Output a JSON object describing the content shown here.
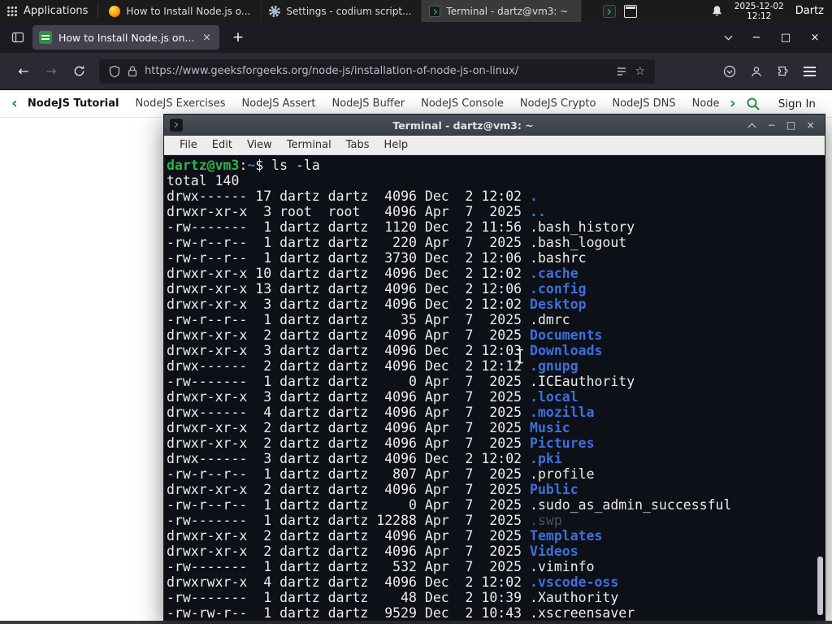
{
  "icons": {
    "back": "←",
    "forward": "→",
    "new_tab": "+",
    "close": "×",
    "minimize": "−",
    "maximize": "□",
    "star": "☆",
    "chev_left": "‹",
    "chev_right": "›"
  },
  "colors": {
    "gfg_green": "#2f8d46",
    "dir_blue": "#3d6fe0",
    "prompt_green": "#2fb34a"
  },
  "panel": {
    "applications": "Applications",
    "tasks": [
      {
        "title": "How to Install Node.js o...",
        "icon": "firefox-icon",
        "state": "normal"
      },
      {
        "title": "Settings - codium script...",
        "icon": "settings-icon",
        "state": "normal"
      },
      {
        "title": "Terminal - dartz@vm3: ~",
        "icon": "terminal-icon",
        "state": "active"
      }
    ],
    "clock": {
      "date": "2025-12-02",
      "time": "12:12"
    },
    "user": "Dartz"
  },
  "browser": {
    "tab_title": "How to Install Node.js on...",
    "url": "https://www.geeksforgeeks.org/node-js/installation-of-node-js-on-linux/",
    "gfg_nav": {
      "items": [
        {
          "label": "NodeJS Tutorial",
          "style": "current"
        },
        {
          "label": "NodeJS Exercises",
          "style": "normal"
        },
        {
          "label": "NodeJS Assert",
          "style": "normal"
        },
        {
          "label": "NodeJS Buffer",
          "style": "normal"
        },
        {
          "label": "NodeJS Console",
          "style": "normal"
        },
        {
          "label": "NodeJS Crypto",
          "style": "normal"
        },
        {
          "label": "NodeJS DNS",
          "style": "normal"
        },
        {
          "label": "Node",
          "style": "normal"
        }
      ],
      "sign_in": "Sign In"
    }
  },
  "terminal": {
    "title": "Terminal - dartz@vm3: ~",
    "menu": [
      "File",
      "Edit",
      "View",
      "Terminal",
      "Tabs",
      "Help"
    ],
    "prompt": {
      "user_host": "dartz@vm3",
      "colon": ":",
      "path": "~",
      "dollar": "$ ",
      "command": "ls -la"
    },
    "total_line": "total 140",
    "listing": [
      {
        "pre": "drwx------ 17 dartz dartz  4096 Dec  2 12:02 ",
        "name": ".",
        "type": "dir"
      },
      {
        "pre": "drwxr-xr-x  3 root  root   4096 Apr  7  2025 ",
        "name": "..",
        "type": "dir"
      },
      {
        "pre": "-rw-------  1 dartz dartz  1120 Dec  2 11:56 ",
        "name": ".bash_history",
        "type": "file"
      },
      {
        "pre": "-rw-r--r--  1 dartz dartz   220 Apr  7  2025 ",
        "name": ".bash_logout",
        "type": "file"
      },
      {
        "pre": "-rw-r--r--  1 dartz dartz  3730 Dec  2 12:06 ",
        "name": ".bashrc",
        "type": "file"
      },
      {
        "pre": "drwxr-xr-x 10 dartz dartz  4096 Dec  2 12:02 ",
        "name": ".cache",
        "type": "dir"
      },
      {
        "pre": "drwxr-xr-x 13 dartz dartz  4096 Dec  2 12:06 ",
        "name": ".config",
        "type": "dir"
      },
      {
        "pre": "drwxr-xr-x  3 dartz dartz  4096 Dec  2 12:02 ",
        "name": "Desktop",
        "type": "dir"
      },
      {
        "pre": "-rw-r--r--  1 dartz dartz    35 Apr  7  2025 ",
        "name": ".dmrc",
        "type": "file"
      },
      {
        "pre": "drwxr-xr-x  2 dartz dartz  4096 Apr  7  2025 ",
        "name": "Documents",
        "type": "dir"
      },
      {
        "pre": "drwxr-xr-x  3 dartz dartz  4096 Dec  2 12:03 ",
        "name": "Downloads",
        "type": "dir"
      },
      {
        "pre": "drwx------  2 dartz dartz  4096 Dec  2 12:12 ",
        "name": ".gnupg",
        "type": "dir"
      },
      {
        "pre": "-rw-------  1 dartz dartz     0 Apr  7  2025 ",
        "name": ".ICEauthority",
        "type": "file"
      },
      {
        "pre": "drwxr-xr-x  3 dartz dartz  4096 Apr  7  2025 ",
        "name": ".local",
        "type": "dir"
      },
      {
        "pre": "drwx------  4 dartz dartz  4096 Apr  7  2025 ",
        "name": ".mozilla",
        "type": "dir"
      },
      {
        "pre": "drwxr-xr-x  2 dartz dartz  4096 Apr  7  2025 ",
        "name": "Music",
        "type": "dir"
      },
      {
        "pre": "drwxr-xr-x  2 dartz dartz  4096 Apr  7  2025 ",
        "name": "Pictures",
        "type": "dir"
      },
      {
        "pre": "drwx------  3 dartz dartz  4096 Dec  2 12:02 ",
        "name": ".pki",
        "type": "dir"
      },
      {
        "pre": "-rw-r--r--  1 dartz dartz   807 Apr  7  2025 ",
        "name": ".profile",
        "type": "file"
      },
      {
        "pre": "drwxr-xr-x  2 dartz dartz  4096 Apr  7  2025 ",
        "name": "Public",
        "type": "dir"
      },
      {
        "pre": "-rw-r--r--  1 dartz dartz     0 Apr  7  2025 ",
        "name": ".sudo_as_admin_successful",
        "type": "file"
      },
      {
        "pre": "-rw-------  1 dartz dartz 12288 Apr  7  2025 ",
        "name": ".swp",
        "type": "dim"
      },
      {
        "pre": "drwxr-xr-x  2 dartz dartz  4096 Apr  7  2025 ",
        "name": "Templates",
        "type": "dir"
      },
      {
        "pre": "drwxr-xr-x  2 dartz dartz  4096 Apr  7  2025 ",
        "name": "Videos",
        "type": "dir"
      },
      {
        "pre": "-rw-------  1 dartz dartz   532 Apr  7  2025 ",
        "name": ".viminfo",
        "type": "file"
      },
      {
        "pre": "drwxrwxr-x  4 dartz dartz  4096 Dec  2 12:02 ",
        "name": ".vscode-oss",
        "type": "dir"
      },
      {
        "pre": "-rw-------  1 dartz dartz    48 Dec  2 10:39 ",
        "name": ".Xauthority",
        "type": "file"
      },
      {
        "pre": "-rw-rw-r--  1 dartz dartz  9529 Dec  2 10:43 ",
        "name": ".xscreensaver",
        "type": "file"
      }
    ]
  }
}
